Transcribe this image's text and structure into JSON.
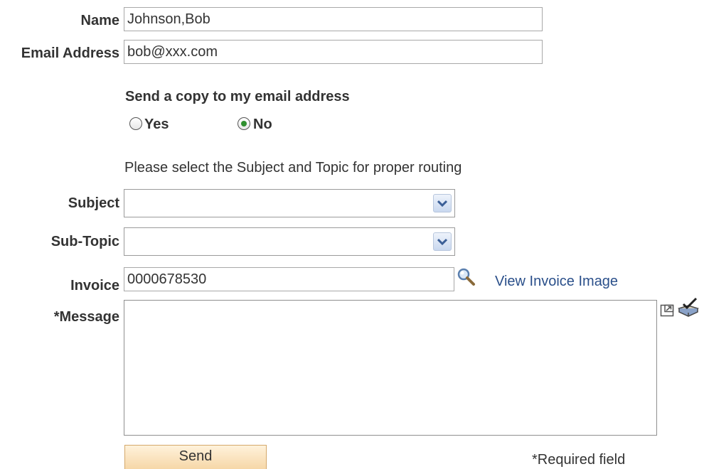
{
  "form": {
    "name_label": "Name",
    "name_value": "Johnson,Bob",
    "email_label": "Email Address",
    "email_value": "bob@xxx.com",
    "copy_heading": "Send a copy to my email address",
    "copy_options": [
      {
        "label": "Yes",
        "selected": false
      },
      {
        "label": "No",
        "selected": true
      }
    ],
    "routing_instruction": "Please select the Subject and Topic for proper routing",
    "subject_label": "Subject",
    "subject_value": "",
    "subtopic_label": "Sub-Topic",
    "subtopic_value": "",
    "invoice_label": "Invoice",
    "invoice_value": "0000678530",
    "view_invoice_link": "View Invoice Image",
    "message_label": "*Message",
    "message_value": "",
    "send_label": "Send",
    "required_note": "*Required field"
  },
  "icons": {
    "lookup": "magnifier-icon",
    "expand": "expand-editor-icon",
    "spellcheck": "spell-check-icon",
    "dropdown": "chevron-down-icon"
  },
  "colors": {
    "link": "#2a4f8a",
    "radio_selected": "#2f8f2f",
    "button_fill": "#f6d7a8",
    "dropdown_button": "#c9d8ef"
  }
}
